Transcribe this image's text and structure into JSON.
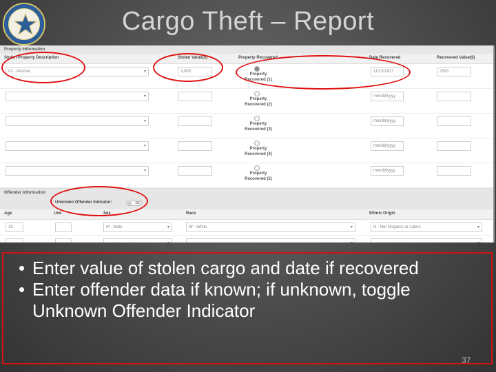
{
  "slide": {
    "title": "Cargo Theft – Report",
    "page_number": "37",
    "bullets": [
      "Enter value of stolen cargo and date if recovered",
      "Enter offender data if known; if unknown, toggle Unknown Offender Indicator"
    ]
  },
  "form": {
    "property_section": "Property Information",
    "property_columns": {
      "description": "Stolen Property Description",
      "stolen_value": "Stolen Value($)",
      "property_recovered": "Property Recovered",
      "date_recovered": "Date Recovered",
      "recovered_value": "Recovered Value($)"
    },
    "property_rows": [
      {
        "description": "02 - Alcohol",
        "stolen_value": "3,000",
        "radio_label": "Property Recovered (1)",
        "date": "11/10/2017",
        "recovered_value": "2500",
        "checked": true
      },
      {
        "description": "",
        "stolen_value": "",
        "radio_label": "Property Recovered (2)",
        "date": "mm/dd/yyyy",
        "recovered_value": "",
        "checked": false
      },
      {
        "description": "",
        "stolen_value": "",
        "radio_label": "Property Recovered (3)",
        "date": "mm/dd/yyyy",
        "recovered_value": "",
        "checked": false
      },
      {
        "description": "",
        "stolen_value": "",
        "radio_label": "Property Recovered (4)",
        "date": "mm/dd/yyyy",
        "recovered_value": "",
        "checked": false
      },
      {
        "description": "",
        "stolen_value": "",
        "radio_label": "Property Recovered (5)",
        "date": "mm/dd/yyyy",
        "recovered_value": "",
        "checked": false
      }
    ],
    "offender_section": "Offender Information",
    "unknown_offender_label": "Unknown Offender Indicator:",
    "toggle_text": "NO",
    "offender_columns": {
      "age": "Age",
      "unknown": "Unk",
      "sex": "Sex",
      "race": "Race",
      "ethnic": "Ethnic Origin"
    },
    "offender_rows": [
      {
        "age": "19",
        "sex": "M - Male",
        "race": "W - White",
        "ethnic": "N - Not Hispanic or Latino"
      },
      {
        "age": "",
        "sex": "",
        "race": "",
        "ethnic": ""
      }
    ]
  },
  "colors": {
    "annotation": "#e01010",
    "bullet_text": "#ffffff",
    "title": "#d5d5d5"
  }
}
